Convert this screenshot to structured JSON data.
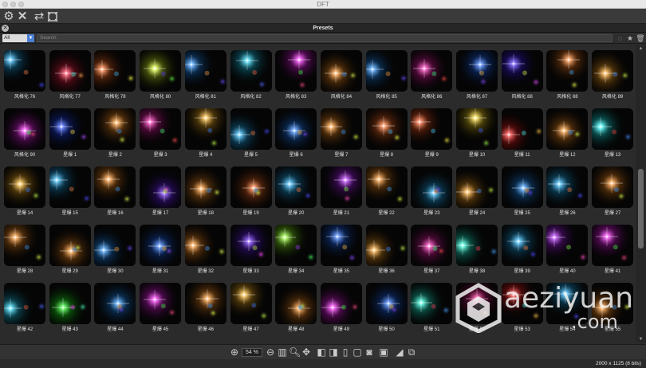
{
  "window": {
    "title": "DFT"
  },
  "toolbar": {
    "icons": [
      "gear-icon",
      "close-x-icon",
      "refresh-icon",
      "fit-frame-icon"
    ]
  },
  "panel": {
    "title": "Presets"
  },
  "filter": {
    "selected": "All",
    "search_placeholder": "Search"
  },
  "presets": [
    {
      "label": "风格化 76",
      "hue": 200
    },
    {
      "label": "风格化 77",
      "hue": 350
    },
    {
      "label": "风格化 78",
      "hue": 20
    },
    {
      "label": "风格化 80",
      "hue": 70
    },
    {
      "label": "风格化 81",
      "hue": 210
    },
    {
      "label": "风格化 82",
      "hue": 190
    },
    {
      "label": "风格化 83",
      "hue": 300
    },
    {
      "label": "风格化 84",
      "hue": 30
    },
    {
      "label": "风格化 85",
      "hue": 210
    },
    {
      "label": "风格化 86",
      "hue": 320
    },
    {
      "label": "风格化 87",
      "hue": 220
    },
    {
      "label": "风格化 88",
      "hue": 250
    },
    {
      "label": "风格化 88",
      "hue": 25
    },
    {
      "label": "风格化 89",
      "hue": 35
    },
    {
      "label": "风格化 90",
      "hue": 300
    },
    {
      "label": "星爆 1",
      "hue": 230
    },
    {
      "label": "星爆 2",
      "hue": 30
    },
    {
      "label": "星爆 3",
      "hue": 320
    },
    {
      "label": "星爆 4",
      "hue": 40
    },
    {
      "label": "星爆 5",
      "hue": 200
    },
    {
      "label": "星爆 6",
      "hue": 215
    },
    {
      "label": "星爆 7",
      "hue": 30
    },
    {
      "label": "星爆 8",
      "hue": 20
    },
    {
      "label": "星爆 9",
      "hue": 15
    },
    {
      "label": "星爆 10",
      "hue": 50
    },
    {
      "label": "星爆 11",
      "hue": 0
    },
    {
      "label": "星爆 12",
      "hue": 30
    },
    {
      "label": "星爆 13",
      "hue": 180
    },
    {
      "label": "星爆 14",
      "hue": 40
    },
    {
      "label": "星爆 15",
      "hue": 200
    },
    {
      "label": "星爆 16",
      "hue": 30
    },
    {
      "label": "星爆 17",
      "hue": 260
    },
    {
      "label": "星爆 18",
      "hue": 30
    },
    {
      "label": "星爆 19",
      "hue": 20
    },
    {
      "label": "星爆 20",
      "hue": 200
    },
    {
      "label": "星爆 21",
      "hue": 280
    },
    {
      "label": "星爆 22",
      "hue": 30
    },
    {
      "label": "星爆 23",
      "hue": 200
    },
    {
      "label": "星爆 24",
      "hue": 35
    },
    {
      "label": "星爆 25",
      "hue": 210
    },
    {
      "label": "星爆 26",
      "hue": 200
    },
    {
      "label": "星爆 27",
      "hue": 30
    },
    {
      "label": "星爆 28",
      "hue": 30
    },
    {
      "label": "星爆 29",
      "hue": 30
    },
    {
      "label": "星爆 30",
      "hue": 210
    },
    {
      "label": "星爆 31",
      "hue": 220
    },
    {
      "label": "星爆 32",
      "hue": 30
    },
    {
      "label": "星爆 33",
      "hue": 260
    },
    {
      "label": "星爆 34",
      "hue": 90
    },
    {
      "label": "星爆 35",
      "hue": 220
    },
    {
      "label": "星爆 36",
      "hue": 35
    },
    {
      "label": "星爆 37",
      "hue": 320
    },
    {
      "label": "星爆 38",
      "hue": 170
    },
    {
      "label": "星爆 39",
      "hue": 200
    },
    {
      "label": "星爆 40",
      "hue": 280
    },
    {
      "label": "星爆 41",
      "hue": 300
    },
    {
      "label": "星爆 42",
      "hue": 190
    },
    {
      "label": "星爆 43",
      "hue": 120
    },
    {
      "label": "星爆 44",
      "hue": 210
    },
    {
      "label": "星爆 45",
      "hue": 300
    },
    {
      "label": "星爆 46",
      "hue": 30
    },
    {
      "label": "星爆 47",
      "hue": 40
    },
    {
      "label": "星爆 48",
      "hue": 30
    },
    {
      "label": "星爆 49",
      "hue": 300
    },
    {
      "label": "星爆 50",
      "hue": 220
    },
    {
      "label": "星爆 51",
      "hue": 170
    },
    {
      "label": "星爆 52",
      "hue": 330
    },
    {
      "label": "星爆 53",
      "hue": 0
    },
    {
      "label": "星爆 54",
      "hue": 200
    },
    {
      "label": "星爆 55",
      "hue": 30
    }
  ],
  "bottombar": {
    "zoom": "54 %",
    "icons": [
      "zoom-in-icon",
      "zoom-out-icon",
      "fit-icon",
      "magnify-icon",
      "move-icon",
      "split-view-icon",
      "split-view-alt-icon",
      "single-view-icon",
      "document-icon",
      "camera-icon",
      "frame-icon",
      "histogram-icon",
      "compare-icon"
    ]
  },
  "status": {
    "resolution": "2000 x 1125 (8 bits)"
  },
  "watermark": {
    "brand": "aeziyuan",
    "tld": ".com"
  }
}
